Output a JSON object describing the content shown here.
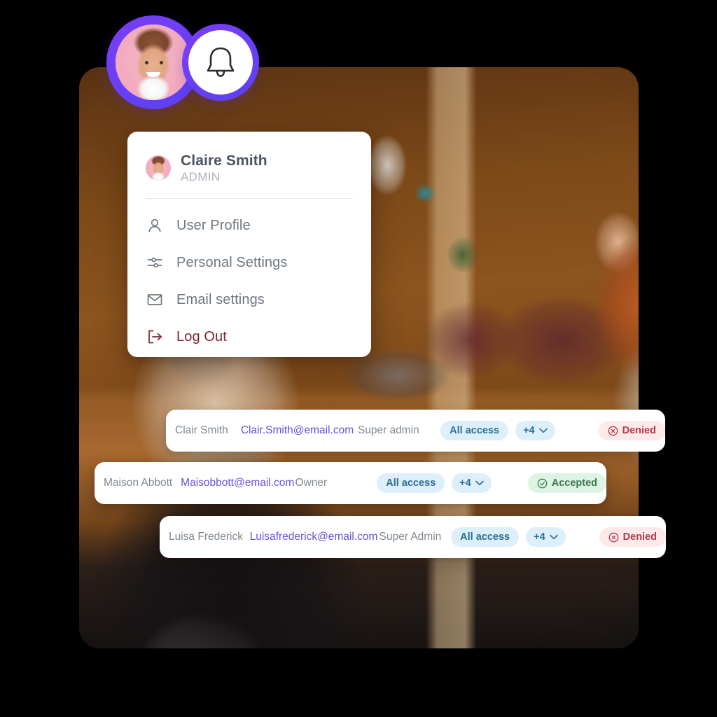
{
  "scene": {
    "description": "Team access management UI overlaid on an office meeting photo",
    "photo_alt": "People working at a table in a warm wood-paneled cafe office, a red-haired woman standing at right"
  },
  "top_badges": [
    {
      "name": "user-avatar-badge",
      "icon": "avatar-photo-icon",
      "ring_color": "#6d40f5"
    },
    {
      "name": "notification-badge",
      "icon": "bell-icon",
      "ring_color": "#6d40f5"
    }
  ],
  "profile_menu": {
    "user": {
      "name": "Claire Smith",
      "role": "ADMIN",
      "avatar_icon": "avatar-photo-icon"
    },
    "items": [
      {
        "label": "User Profile",
        "icon": "user-icon",
        "danger": false
      },
      {
        "label": "Personal Settings",
        "icon": "sliders-icon",
        "danger": false
      },
      {
        "label": "Email settings",
        "icon": "envelope-icon",
        "danger": false
      },
      {
        "label": "Log Out",
        "icon": "logout-icon",
        "danger": true
      }
    ]
  },
  "access_table": {
    "rows": [
      {
        "name": "Clair Smith",
        "email": "Clair.Smith@email.com",
        "role": "Super admin",
        "access_label": "All access",
        "more_label": "+4",
        "status": "Denied",
        "status_icon": "circle-x-icon"
      },
      {
        "name": "Maison Abbott",
        "email": "Maisobbott@email.com",
        "role": "Owner",
        "access_label": "All access",
        "more_label": "+4",
        "status": "Accepted",
        "status_icon": "circle-check-icon"
      },
      {
        "name": "Luisa Frederick",
        "email": "Luisafrederick@email.com",
        "role": "Super Admin",
        "access_label": "All access",
        "more_label": "+4",
        "status": "Denied",
        "status_icon": "circle-x-icon"
      }
    ]
  },
  "colors": {
    "accent_purple": "#6d40f5",
    "email_link": "#6b4fd8",
    "pill_access_bg": "#ddeffb",
    "pill_access_text": "#2a6f96",
    "pill_denied_bg": "#fde8ea",
    "pill_denied_text": "#b33b4a",
    "pill_accepted_bg": "#ddf3e3",
    "pill_accepted_text": "#3c7a52",
    "logout_red": "#7e2230",
    "menu_text": "#6f7780"
  }
}
